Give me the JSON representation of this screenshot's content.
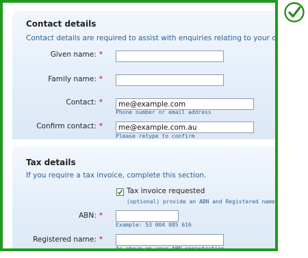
{
  "contact": {
    "title": "Contact details",
    "description": "Contact details are required to assist with enquiries relating to your order.",
    "given_name_label": "Given name:",
    "given_name_value": "",
    "family_name_label": "Family name:",
    "family_name_value": "",
    "contact_label": "Contact:",
    "contact_value": "me@example.com",
    "contact_hint": "Phone number or email address",
    "confirm_label": "Confirm contact:",
    "confirm_value": "me@example.com.au",
    "confirm_hint": "Please retype to confirm",
    "required_mark": "*"
  },
  "tax": {
    "title": "Tax details",
    "description": "If you require a tax invoice, complete this section.",
    "invoice_checkbox_label": "Tax invoice requested",
    "invoice_checked": true,
    "invoice_hint": "(optional) provide an ABN and Registered name for this",
    "abn_label": "ABN:",
    "abn_value": "",
    "abn_hint": "Example: 53 004 085 616",
    "registered_label": "Registered name:",
    "registered_value": "",
    "registered_hint": "As shown on your ABN registration",
    "required_mark": "*"
  },
  "colors": {
    "frame_border": "#1f9a1f",
    "required": "#cc0000",
    "hint_text": "#2b5f94",
    "checkmark": "#2a8a1e"
  },
  "icons": {
    "status": "green-checkmark-icon"
  }
}
